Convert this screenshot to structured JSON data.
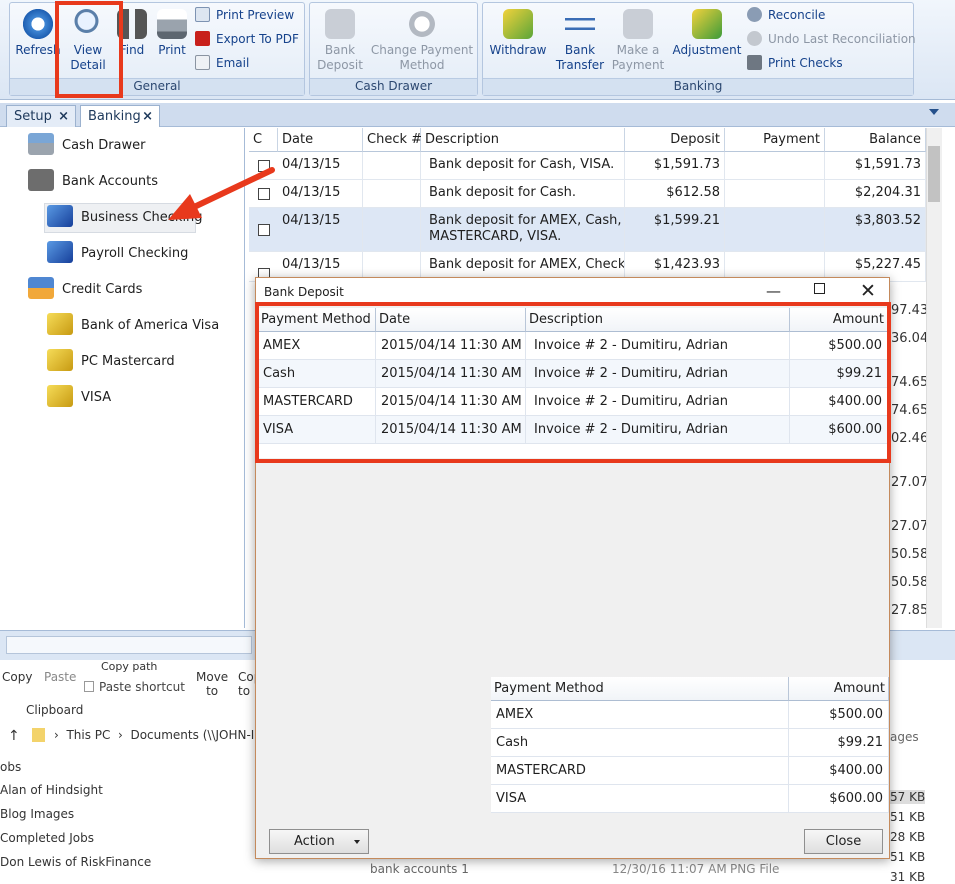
{
  "ribbon": {
    "general": {
      "caption": "General",
      "refresh": "Refresh",
      "view_detail_1": "View",
      "view_detail_2": "Detail",
      "find": "Find",
      "print": "Print",
      "print_preview": "Print Preview",
      "export_pdf": "Export To PDF",
      "email": "Email"
    },
    "cash_drawer": {
      "caption": "Cash Drawer",
      "bank_deposit_1": "Bank",
      "bank_deposit_2": "Deposit",
      "change_payment_1": "Change Payment",
      "change_payment_2": "Method"
    },
    "banking": {
      "caption": "Banking",
      "withdraw": "Withdraw",
      "bank_transfer_1": "Bank",
      "bank_transfer_2": "Transfer",
      "make_payment_1": "Make a",
      "make_payment_2": "Payment",
      "adjustment": "Adjustment",
      "reconcile": "Reconcile",
      "undo_reconcile": "Undo Last Reconciliation",
      "print_checks": "Print Checks"
    }
  },
  "tabs": [
    {
      "label": "Setup",
      "close": "×"
    },
    {
      "label": "Banking",
      "close": "×"
    }
  ],
  "tree": {
    "cash_drawer": "Cash Drawer",
    "bank_accounts": "Bank Accounts",
    "business_checking": "Business Checking",
    "payroll_checking": "Payroll Checking",
    "credit_cards": "Credit Cards",
    "boa_visa": "Bank of America Visa",
    "pc_mastercard": "PC Mastercard",
    "visa": "VISA"
  },
  "grid": {
    "headers": {
      "c": "C",
      "date": "Date",
      "check": "Check #",
      "description": "Description",
      "deposit": "Deposit",
      "payment": "Payment",
      "balance": "Balance"
    },
    "rows": [
      {
        "date": "04/13/15",
        "check": "",
        "desc1": "Bank deposit for Cash, VISA.",
        "desc2": "",
        "deposit": "$1,591.73",
        "payment": "",
        "balance": "$1,591.73"
      },
      {
        "date": "04/13/15",
        "check": "",
        "desc1": "Bank deposit for Cash.",
        "desc2": "",
        "deposit": "$612.58",
        "payment": "",
        "balance": "$2,204.31"
      },
      {
        "date": "04/13/15",
        "check": "",
        "desc1": "Bank deposit for AMEX, Cash,",
        "desc2": "MASTERCARD, VISA.",
        "deposit": "$1,599.21",
        "payment": "",
        "balance": "$3,803.52"
      },
      {
        "date": "04/13/15",
        "check": "",
        "desc1": "Bank deposit for AMEX, Check,",
        "desc2": "",
        "deposit": "$1,423.93",
        "payment": "",
        "balance": "$5,227.45"
      }
    ],
    "partial_balances": [
      "97.43",
      "36.04",
      "74.65",
      "74.65",
      "02.46",
      "27.07",
      "27.07",
      "50.58",
      "50.58",
      "27.85"
    ]
  },
  "explorer": {
    "copy": "Copy",
    "paste": "Paste",
    "copy_path": "Copy path",
    "paste_shortcut": "Paste shortcut",
    "move_to_1": "Move",
    "move_to_2": "to",
    "copy_to_1": "Cop",
    "copy_to_2": "to",
    "clipboard": "Clipboard",
    "path_pc": "This PC",
    "path_docs": "Documents (\\\\JOHN-IM",
    "items": [
      "obs",
      "Alan of Hindsight",
      "Blog Images",
      "Completed Jobs",
      "Don Lewis of RiskFinance"
    ],
    "right_ages": "ages",
    "sizes": [
      "57 KB",
      "51 KB",
      "28 KB",
      "51 KB",
      "31 KB"
    ],
    "last_file": "bank accounts 1",
    "last_date": "12/30/16 11:07 AM",
    "last_type": "PNG File"
  },
  "dialog": {
    "title": "Bank Deposit",
    "detail_headers": {
      "method": "Payment Method",
      "date": "Date",
      "description": "Description",
      "amount": "Amount"
    },
    "detail_rows": [
      {
        "method": "AMEX",
        "date": "2015/04/14 11:30 AM",
        "description": "Invoice # 2 - Dumitiru, Adrian",
        "amount": "$500.00"
      },
      {
        "method": "Cash",
        "date": "2015/04/14 11:30 AM",
        "description": "Invoice # 2 - Dumitiru, Adrian",
        "amount": "$99.21"
      },
      {
        "method": "MASTERCARD",
        "date": "2015/04/14 11:30 AM",
        "description": "Invoice # 2 - Dumitiru, Adrian",
        "amount": "$400.00"
      },
      {
        "method": "VISA",
        "date": "2015/04/14 11:30 AM",
        "description": "Invoice # 2 - Dumitiru, Adrian",
        "amount": "$600.00"
      }
    ],
    "summary_headers": {
      "method": "Payment Method",
      "amount": "Amount"
    },
    "summary_rows": [
      {
        "method": "AMEX",
        "amount": "$500.00"
      },
      {
        "method": "Cash",
        "amount": "$99.21"
      },
      {
        "method": "MASTERCARD",
        "amount": "$400.00"
      },
      {
        "method": "VISA",
        "amount": "$600.00"
      }
    ],
    "action_label": "Action",
    "close_label": "Close"
  },
  "colors": {
    "highlight": "#e8391c",
    "ribbon_text": "#15428b",
    "selected_row": "#dde7f5"
  }
}
